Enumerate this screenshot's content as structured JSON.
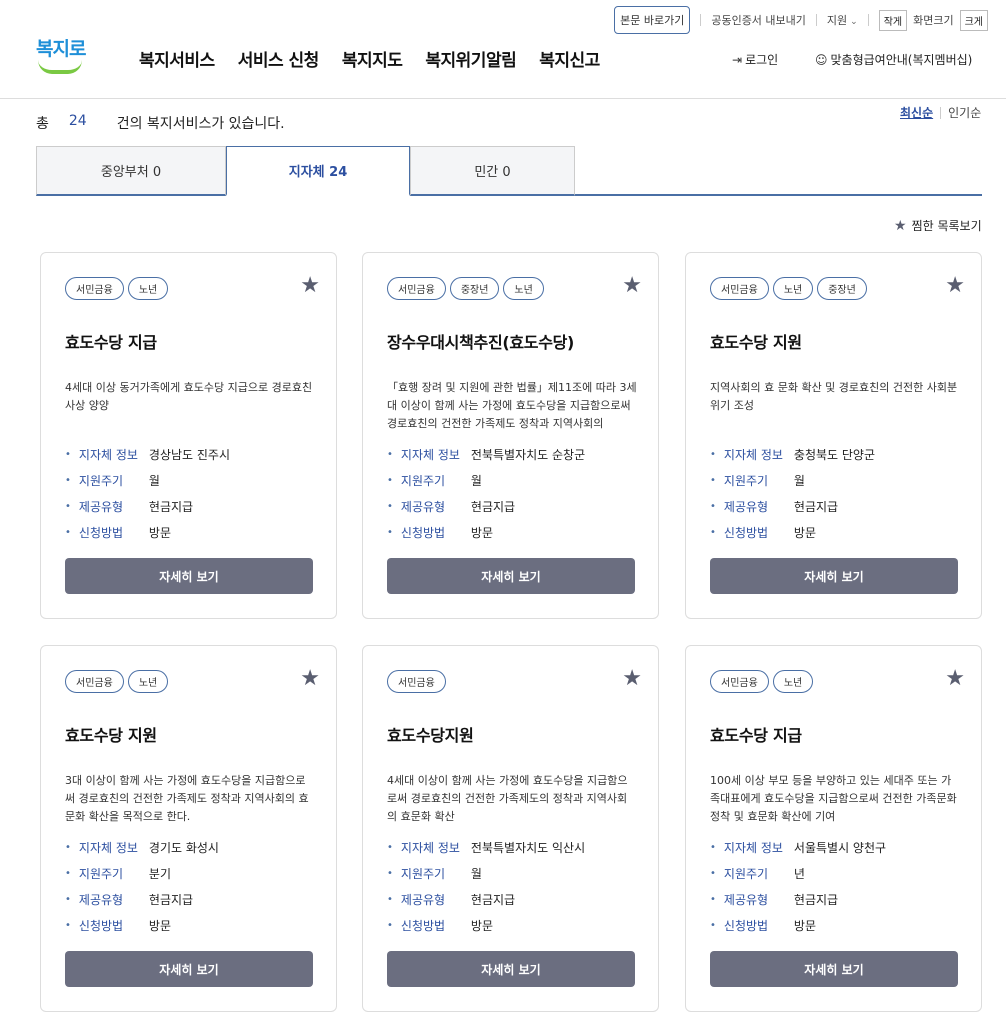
{
  "utility": {
    "skip": "본문 바로가기",
    "cert": "공동인증서 내보내기",
    "support": "지원",
    "small": "작게",
    "size": "화면크기",
    "large": "크게"
  },
  "header": {
    "logo_text": "복지로",
    "nav": [
      "복지서비스",
      "서비스 신청",
      "복지지도",
      "복지위기알림",
      "복지신고"
    ],
    "login": "로그인",
    "member": "맞춤형급여안내(복지멤버십)"
  },
  "summary": {
    "prefix": "총",
    "count": "24",
    "suffix": "건의 복지서비스가 있습니다.",
    "sort_latest": "최신순",
    "sort_popular": "인기순"
  },
  "tabs": [
    {
      "label": "중앙부처 0"
    },
    {
      "label": "지자체 24"
    },
    {
      "label": "민간 0"
    }
  ],
  "fav_list_label": "찜한 목록보기",
  "info_labels": {
    "region": "지자체 정보",
    "cycle": "지원주기",
    "type": "제공유형",
    "method": "신청방법"
  },
  "detail_button": "자세히 보기",
  "cards": [
    {
      "tags": [
        "서민금융",
        "노년"
      ],
      "title": "효도수당 지급",
      "desc": "4세대 이상 동거가족에게 효도수당 지급으로 경로효친 사상 양양",
      "region": "경상남도 진주시",
      "cycle": "월",
      "type": "현금지급",
      "method": "방문"
    },
    {
      "tags": [
        "서민금융",
        "중장년",
        "노년"
      ],
      "title": "장수우대시책추진(효도수당)",
      "desc": "「효행 장려 및 지원에 관한 법률」제11조에 따라 3세대 이상이 함께 사는 가정에 효도수당을 지급함으로써 경로효친의 건전한 가족제도 정착과 지역사회의",
      "region": "전북특별자치도 순창군",
      "cycle": "월",
      "type": "현금지급",
      "method": "방문"
    },
    {
      "tags": [
        "서민금융",
        "노년",
        "중장년"
      ],
      "title": "효도수당 지원",
      "desc": "지역사회의 효 문화 확산 및 경로효친의 건전한 사회분위기 조성",
      "region": "충청북도 단양군",
      "cycle": "월",
      "type": "현금지급",
      "method": "방문"
    },
    {
      "tags": [
        "서민금융",
        "노년"
      ],
      "title": "효도수당 지원",
      "desc": "3대 이상이 함께 사는 가정에 효도수당을 지급함으로써 경로효친의 건전한 가족제도 정착과 지역사회의 효 문화 확산을 목적으로 한다.",
      "region": "경기도 화성시",
      "cycle": "분기",
      "type": "현금지급",
      "method": "방문"
    },
    {
      "tags": [
        "서민금융"
      ],
      "title": "효도수당지원",
      "desc": "4세대 이상이 함께 사는 가정에 효도수당을 지급함으로써 경로효친의 건전한 가족제도의 정착과 지역사회의 효문화 확산",
      "region": "전북특별자치도 익산시",
      "cycle": "월",
      "type": "현금지급",
      "method": "방문"
    },
    {
      "tags": [
        "서민금융",
        "노년"
      ],
      "title": "효도수당 지급",
      "desc": "100세 이상 부모 등을 부양하고 있는 세대주 또는 가족대표에게 효도수당을 지급함으로써 건전한 가족문화 정착 및 효문화 확산에 기여",
      "region": "서울특별시 양천구",
      "cycle": "년",
      "type": "현금지급",
      "method": "방문"
    }
  ]
}
